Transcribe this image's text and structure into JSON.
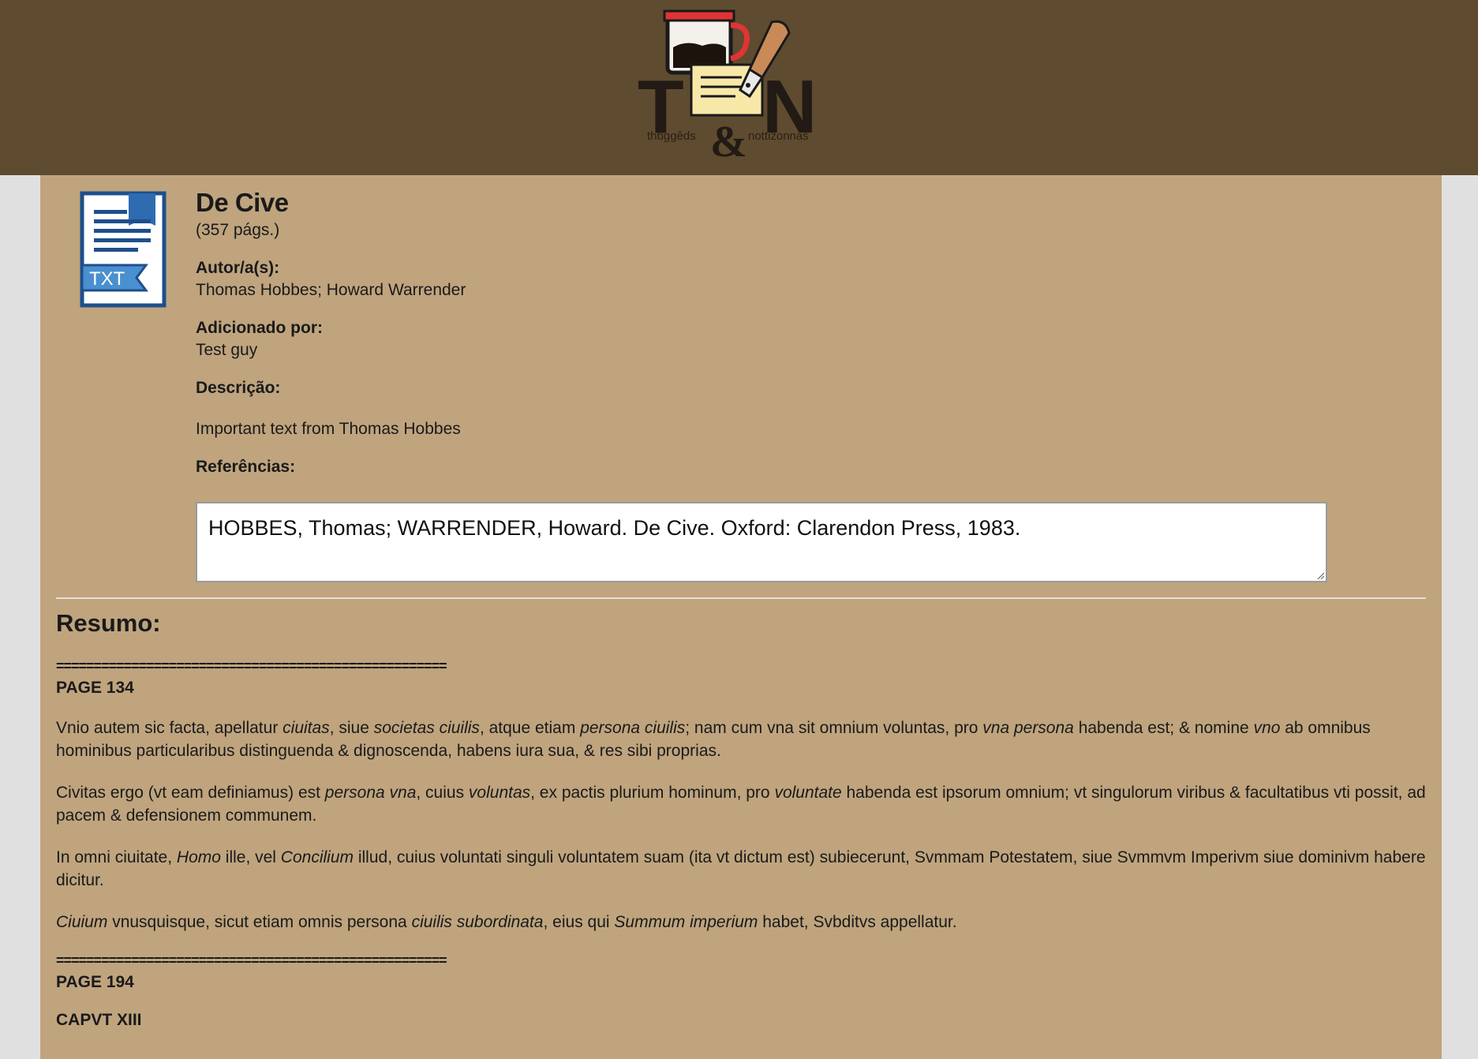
{
  "header": {
    "logo_letters": "T&N",
    "logo_left_word": "thbggêds",
    "logo_right_word": "nottizonnas",
    "bg_color": "#5f4b2f"
  },
  "document": {
    "icon": "txt-file-icon",
    "icon_label": "TXT",
    "title": "De Cive",
    "pages": "(357 págs.)",
    "author_label": "Autor/a(s):",
    "authors": "Thomas Hobbes; Howard Warrender",
    "added_by_label": "Adicionado por:",
    "added_by": "Test guy",
    "description_label": "Descrição:",
    "description": "Important text from Thomas Hobbes",
    "references_label": "Referências:",
    "references": "HOBBES, Thomas; WARRENDER, Howard. De Cive. Oxford: Clarendon Press, 1983."
  },
  "summary": {
    "heading": "Resumo:",
    "separator": "====================================================",
    "page1_label": "PAGE 134",
    "p1": [
      {
        "t": "Vnio autem sic facta, apellatur "
      },
      {
        "i": "ciuitas"
      },
      {
        "t": ", siue "
      },
      {
        "i": "societas ciuilis"
      },
      {
        "t": ", atque etiam "
      },
      {
        "i": "persona ciuilis"
      },
      {
        "t": "; nam cum vna sit omnium voluntas, pro "
      },
      {
        "i": "vna persona"
      },
      {
        "t": " habenda est; & nomine "
      },
      {
        "i": "vno"
      },
      {
        "t": " ab omnibus hominibus particularibus distinguenda & dignoscenda, habens iura sua, & res sibi proprias."
      }
    ],
    "p2": [
      {
        "t": "Civitas ergo (vt eam definiamus) est "
      },
      {
        "i": "persona vna"
      },
      {
        "t": ", cuius "
      },
      {
        "i": "voluntas"
      },
      {
        "t": ", ex pactis plurium hominum, pro "
      },
      {
        "i": "voluntate"
      },
      {
        "t": " habenda est ipsorum omnium; vt singulorum viribus & facultatibus vti possit, ad pacem & defensionem communem."
      }
    ],
    "p3": [
      {
        "t": "In omni ciuitate, "
      },
      {
        "i": "Homo"
      },
      {
        "t": " ille, vel "
      },
      {
        "i": "Concilium"
      },
      {
        "t": " illud, cuius voluntati singuli voluntatem suam (ita vt dictum est) subiecerunt, Svmmam Potestatem, siue Svmmvm Imperivm siue dominivm habere dicitur."
      }
    ],
    "p4": [
      {
        "i": "Ciuium"
      },
      {
        "t": " vnusquisque, sicut etiam omnis persona "
      },
      {
        "i": "ciuilis subordinata"
      },
      {
        "t": ", eius qui "
      },
      {
        "i": "Summum imperium"
      },
      {
        "t": " habet, Svbditvs appellatur."
      }
    ],
    "separator2": "====================================================",
    "page2_label": "PAGE 194",
    "chapter": "CAPVT XIII"
  }
}
